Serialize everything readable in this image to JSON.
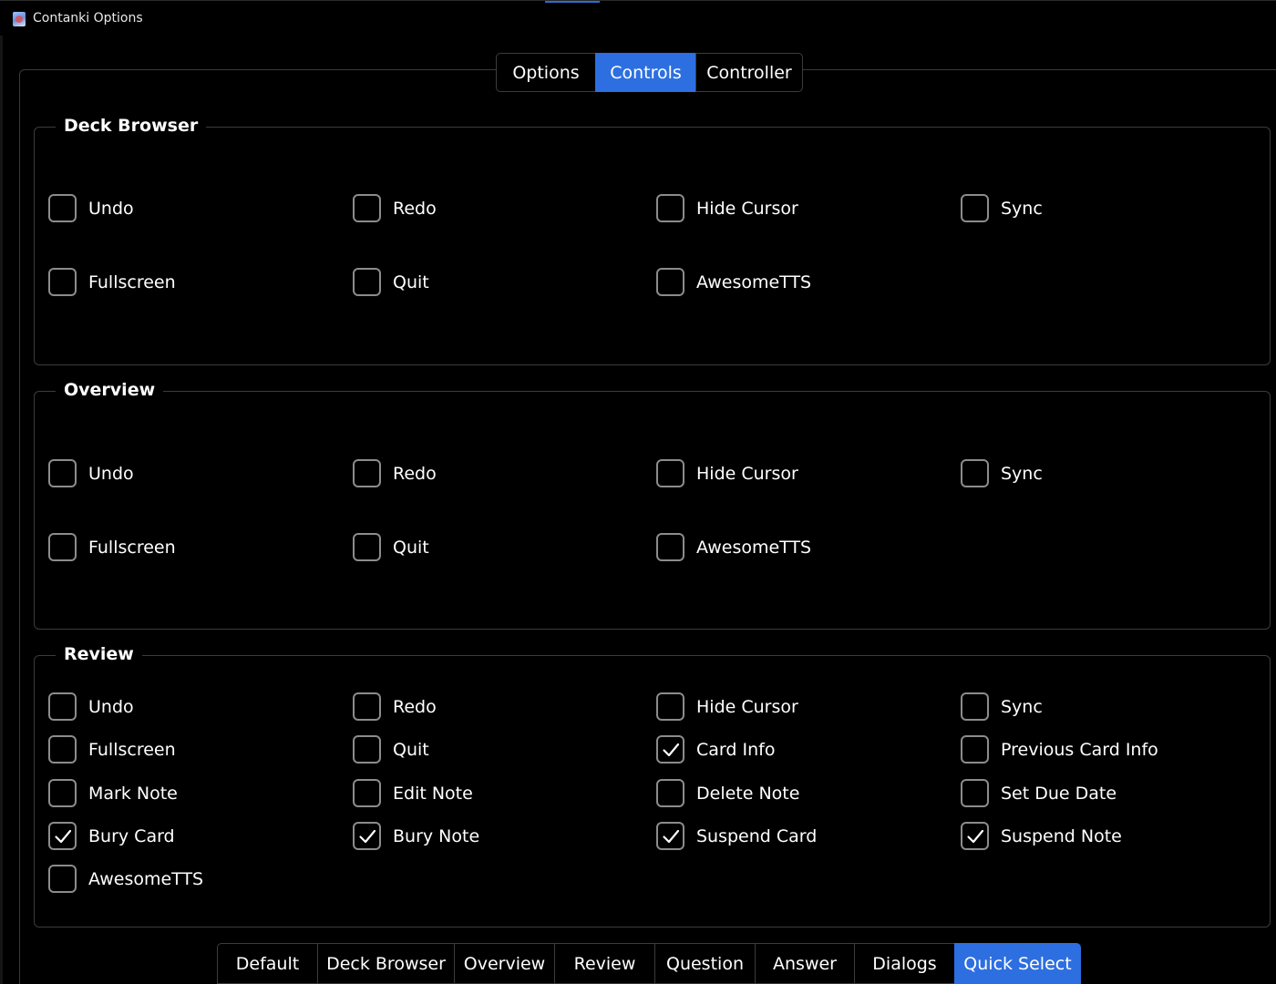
{
  "window": {
    "title": "Contanki Options"
  },
  "top_tabs": [
    {
      "label": "Options",
      "active": false
    },
    {
      "label": "Controls",
      "active": true
    },
    {
      "label": "Controller",
      "active": false
    }
  ],
  "groups": [
    {
      "title": "Deck Browser",
      "items": [
        {
          "label": "Undo",
          "checked": false
        },
        {
          "label": "Redo",
          "checked": false
        },
        {
          "label": "Hide Cursor",
          "checked": false
        },
        {
          "label": "Sync",
          "checked": false
        },
        {
          "label": "Fullscreen",
          "checked": false
        },
        {
          "label": "Quit",
          "checked": false
        },
        {
          "label": "AwesomeTTS",
          "checked": false
        }
      ]
    },
    {
      "title": "Overview",
      "items": [
        {
          "label": "Undo",
          "checked": false
        },
        {
          "label": "Redo",
          "checked": false
        },
        {
          "label": "Hide Cursor",
          "checked": false
        },
        {
          "label": "Sync",
          "checked": false
        },
        {
          "label": "Fullscreen",
          "checked": false
        },
        {
          "label": "Quit",
          "checked": false
        },
        {
          "label": "AwesomeTTS",
          "checked": false
        }
      ]
    },
    {
      "title": "Review",
      "items": [
        {
          "label": "Undo",
          "checked": false
        },
        {
          "label": "Redo",
          "checked": false
        },
        {
          "label": "Hide Cursor",
          "checked": false
        },
        {
          "label": "Sync",
          "checked": false
        },
        {
          "label": "Fullscreen",
          "checked": false
        },
        {
          "label": "Quit",
          "checked": false
        },
        {
          "label": "Card Info",
          "checked": true
        },
        {
          "label": "Previous Card Info",
          "checked": false
        },
        {
          "label": "Mark Note",
          "checked": false
        },
        {
          "label": "Edit Note",
          "checked": false
        },
        {
          "label": "Delete Note",
          "checked": false
        },
        {
          "label": "Set Due Date",
          "checked": false
        },
        {
          "label": "Bury Card",
          "checked": true
        },
        {
          "label": "Bury Note",
          "checked": true
        },
        {
          "label": "Suspend Card",
          "checked": true
        },
        {
          "label": "Suspend Note",
          "checked": true
        },
        {
          "label": "AwesomeTTS",
          "checked": false
        }
      ]
    }
  ],
  "bottom_tabs": [
    {
      "label": "Default",
      "active": false
    },
    {
      "label": "Deck Browser",
      "active": false
    },
    {
      "label": "Overview",
      "active": false
    },
    {
      "label": "Review",
      "active": false
    },
    {
      "label": "Question",
      "active": false
    },
    {
      "label": "Answer",
      "active": false
    },
    {
      "label": "Dialogs",
      "active": false
    },
    {
      "label": "Quick Select",
      "active": true
    }
  ]
}
